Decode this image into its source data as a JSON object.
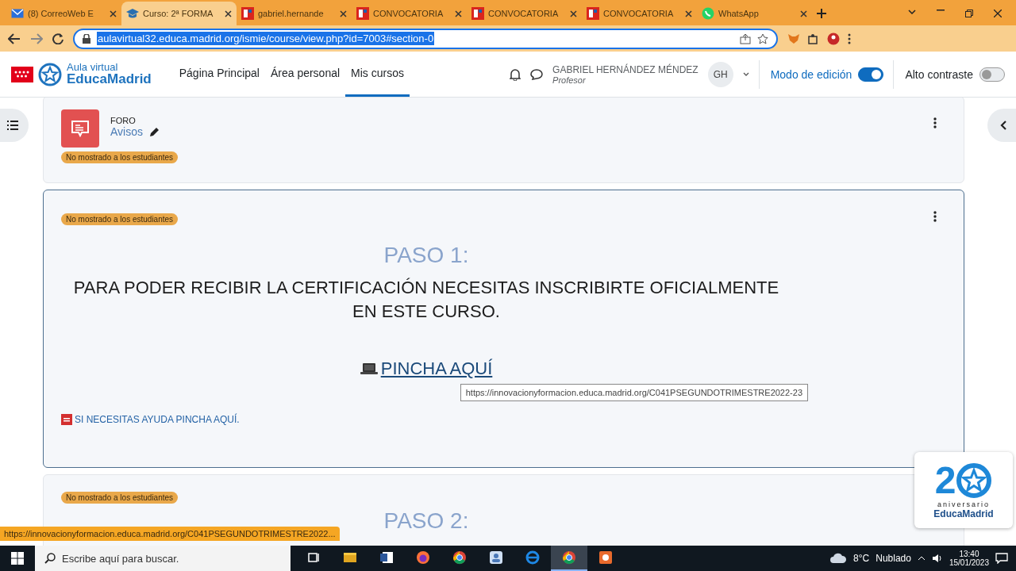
{
  "browser": {
    "tabs": [
      {
        "kind": "mail",
        "title": "(8) CorreoWeb E",
        "selected": false
      },
      {
        "kind": "course",
        "title": "Curso: 2ª FORMA",
        "selected": true
      },
      {
        "kind": "site",
        "title": "gabriel.hernande",
        "selected": false
      },
      {
        "kind": "site",
        "title": "CONVOCATORIA",
        "selected": false
      },
      {
        "kind": "site",
        "title": "CONVOCATORIA",
        "selected": false
      },
      {
        "kind": "site",
        "title": "CONVOCATORIA",
        "selected": false
      },
      {
        "kind": "whatsapp",
        "title": "WhatsApp",
        "selected": false
      }
    ],
    "url": "aulavirtual32.educa.madrid.org/ismie/course/view.php?id=7003#section-0"
  },
  "header": {
    "logo": {
      "line1": "Aula virtual",
      "line2": "EducaMadrid"
    },
    "nav": [
      {
        "label": "Página Principal",
        "selected": false
      },
      {
        "label": "Área personal",
        "selected": false
      },
      {
        "label": "Mis cursos",
        "selected": true
      }
    ],
    "user": {
      "name": "GABRIEL HERNÁNDEZ MÉNDEZ",
      "role": "Profesor",
      "initials": "GH"
    },
    "switches": [
      {
        "label": "Modo de edición",
        "on": true
      },
      {
        "label": "Alto contraste",
        "on": false
      }
    ]
  },
  "sections": [
    {
      "kind": "forum",
      "type_label": "FORO",
      "title": "Avisos",
      "badge": "No mostrado a los estudiantes",
      "highlighted": false
    },
    {
      "kind": "text",
      "badge": "No mostrado a los estudiantes",
      "step": "PASO 1:",
      "heading": "PARA PODER RECIBIR LA CERTIFICACIÓN NECESITAS INSCRIBIRTE OFICIALMENTE EN ESTE CURSO.",
      "link": "PINCHA AQUÍ",
      "tooltip": "https://innovacionyformacion.educa.madrid.org/C041PSEGUNDOTRIMESTRE2022-23",
      "help": "SI NECESITAS AYUDA PINCHA AQUÍ.",
      "highlighted": true
    },
    {
      "kind": "text",
      "badge": "No mostrado a los estudiantes",
      "step": "PASO 2:",
      "highlighted": false
    }
  ],
  "status_link": "https://innovacionyformacion.educa.madrid.org/C041PSEGUNDOTRIMESTRE2022...",
  "anniversary": {
    "number": "2",
    "line1": "aniversario",
    "line2": "EducaMadrid"
  },
  "taskbar": {
    "search_placeholder": "Escribe aquí para buscar.",
    "apps": [
      {
        "kind": "taskview",
        "selected": false
      },
      {
        "kind": "explorer",
        "selected": false
      },
      {
        "kind": "word",
        "selected": false
      },
      {
        "kind": "firefox",
        "selected": false
      },
      {
        "kind": "chrome",
        "selected": false
      },
      {
        "kind": "photos",
        "selected": false
      },
      {
        "kind": "edge",
        "selected": false
      },
      {
        "kind": "chrome",
        "selected": true
      },
      {
        "kind": "recorder",
        "selected": false
      }
    ],
    "weather": {
      "temp": "8°C",
      "condition": "Nublado"
    },
    "time": "13:40",
    "date": "15/01/2023"
  }
}
